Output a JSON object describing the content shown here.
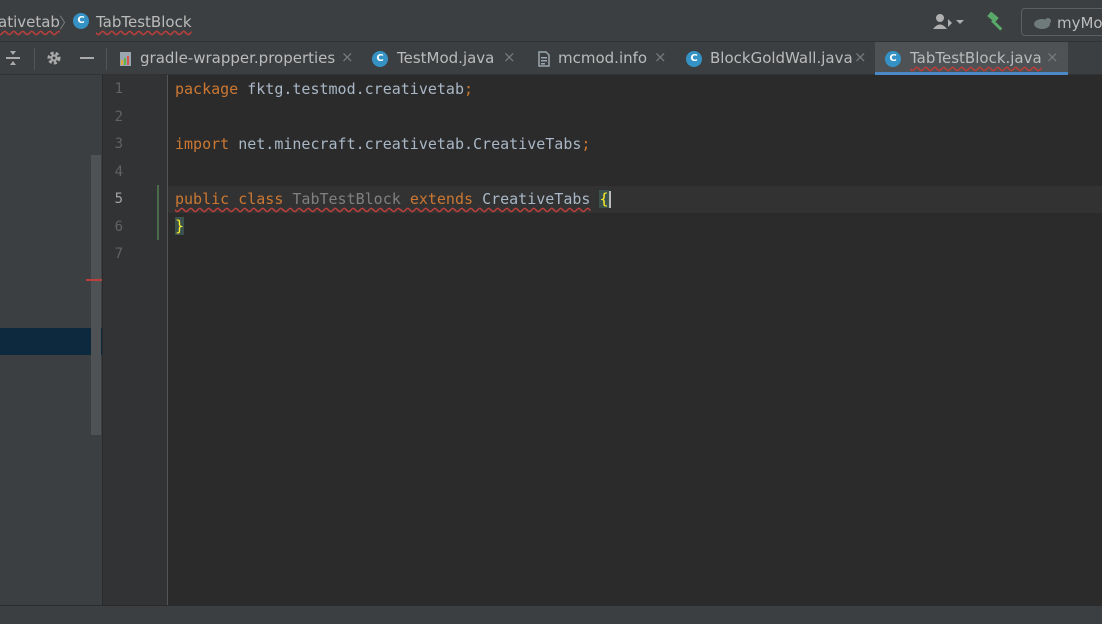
{
  "breadcrumb": {
    "package_label": "ativetab",
    "separator": "〉",
    "class_icon_letter": "C",
    "class_label": "TabTestBlock"
  },
  "toolbar": {
    "run_config_label": "myMo"
  },
  "tabs": [
    {
      "label": "gradle-wrapper.properties",
      "icon": "gradle-file-icon",
      "active": false
    },
    {
      "label": "TestMod.java",
      "icon": "java-class-icon",
      "active": false
    },
    {
      "label": "mcmod.info",
      "icon": "text-file-icon",
      "active": false
    },
    {
      "label": "BlockGoldWall.java",
      "icon": "java-class-icon",
      "active": false
    },
    {
      "label": "TabTestBlock.java",
      "icon": "java-class-icon",
      "active": true
    }
  ],
  "tab_close_glyph": "×",
  "gutter": {
    "line_numbers": [
      "1",
      "2",
      "3",
      "4",
      "5",
      "6",
      "7"
    ],
    "current_line": "5"
  },
  "code": {
    "line1_kw": "package",
    "line1_rest": " fktg.testmod.creativetab",
    "line1_semi": ";",
    "line3_kw": "import",
    "line3_rest": " net.minecraft.creativetab.CreativeTabs",
    "line3_semi": ";",
    "line5_kw1": "public",
    "line5_kw2": "class",
    "line5_name": "TabTestBlock",
    "line5_kw3": "extends",
    "line5_super": "CreativeTabs",
    "line5_brace": "{",
    "line6_brace": "}"
  },
  "colors": {
    "keyword": "#cc7832",
    "identifier": "#a9b7c6",
    "unused_class": "#808080",
    "brace_highlight": "#ffef28",
    "tab_underline": "#4a88c7",
    "class_icon": "#3592c4",
    "error_underline": "#bc3f3c"
  }
}
